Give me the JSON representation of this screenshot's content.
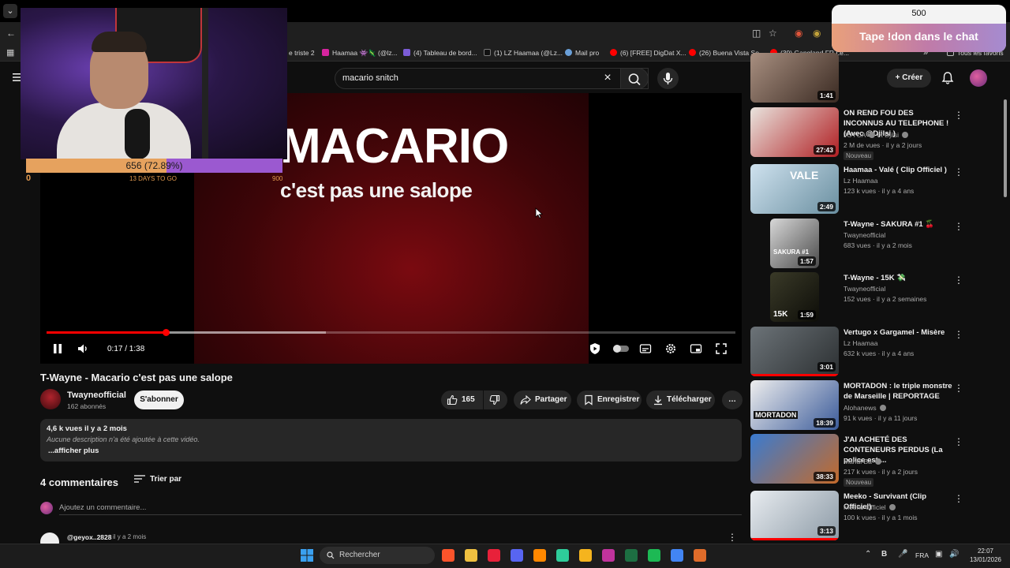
{
  "browser": {
    "bookmarks": [
      {
        "label": "e triste 2",
        "color": "#666666"
      },
      {
        "label": "Haamaa 👾🦎 (@lz...",
        "color": "#d6249f"
      },
      {
        "label": "(4) Tableau de bord...",
        "color": "#7b5cd6"
      },
      {
        "label": "(1) LZ Haamaa (@Lz...",
        "color": "#111111"
      },
      {
        "label": "Mail pro",
        "color": "#6a9fd8"
      },
      {
        "label": "(6) [FREE] DigDat X...",
        "color": "#ff0000"
      },
      {
        "label": "(26) Buena Vista So...",
        "color": "#ff0000"
      },
      {
        "label": "(39) Gangland FR Le...",
        "color": "#ff0000"
      }
    ],
    "favorites_label": "Tous les favoris",
    "more_glyph": "»"
  },
  "stream_overlay": {
    "goal": {
      "label": "656 (72.89%)",
      "min": "0",
      "max": "900",
      "days_left": "13 DAYS TO GO",
      "fraction": 0.7289
    },
    "donation": {
      "amount": "500",
      "cta": "Tape !don dans le chat"
    }
  },
  "masthead": {
    "search_query": "macario snitch",
    "create_label": "Créer"
  },
  "player": {
    "frame_line1": "MACARIO",
    "frame_line2": "c'est pas une salope",
    "time_display": "0:17 / 1:38",
    "played_fraction": 0.1735,
    "buffered_fraction": 0.405
  },
  "video": {
    "title": "T-Wayne - Macario c'est pas une salope",
    "channel": "Twayneofficial",
    "subscribers": "162 abonnés",
    "subscribe_label": "S'abonner",
    "likes": "165",
    "share_label": "Partager",
    "save_label": "Enregistrer",
    "download_label": "Télécharger",
    "description": {
      "meta": "4,6 k vues  il y a 2 mois",
      "text": "Aucune description n'a été ajoutée à cette vidéo.",
      "more": "...afficher plus"
    }
  },
  "comments": {
    "count_label": "4 commentaires",
    "sort_label": "Trier par",
    "add_placeholder": "Ajoutez un commentaire...",
    "first": {
      "author": "@geyox..2828",
      "time": "il y a 2 mois"
    }
  },
  "recommendations": [
    {
      "title": "",
      "channel": "",
      "meta": "",
      "duration": "1:41",
      "thumb": [
        "#a88f80",
        "#3a2a22"
      ]
    },
    {
      "title": "ON REND FOU DES INCONNUS AU TELEPHONE ! (Avec @Djilsi )",
      "channel": "JOYCA",
      "channel2": "et Djilsi",
      "meta": "2 M de vues · il y a 2 jours",
      "badge": "Nouveau",
      "duration": "27:43",
      "thumb": [
        "#e9e4de",
        "#b01e22"
      ]
    },
    {
      "title": "Haamaa - Valé ( Clip Officiel )",
      "channel": "Lz Haamaa",
      "meta": "123 k vues · il y a 4 ans",
      "duration": "2:49",
      "thumb": [
        "#cfe2ef",
        "#6a8fa0"
      ],
      "label": "VALE"
    },
    {
      "title": "T-Wayne - SAKURA #1 🍒",
      "channel": "Twayneofficial",
      "meta": "683 vues · il y a 2 mois",
      "duration": "1:57",
      "thumb": [
        "#d8d8d8",
        "#4a4a4a"
      ],
      "label": "SAKURA #1"
    },
    {
      "title": "T-Wayne - 15K 💸",
      "channel": "Twayneofficial",
      "meta": "152 vues · il y a 2 semaines",
      "duration": "1:59",
      "thumb": [
        "#3a3a28",
        "#0d0d08"
      ],
      "label": "15K"
    },
    {
      "title": "Vertugo x Gargamel - Misère",
      "channel": "Lz Haamaa",
      "meta": "632 k vues · il y a 4 ans",
      "duration": "3:01",
      "thumb": [
        "#6c7378",
        "#2c3032"
      ],
      "watched": 1.0
    },
    {
      "title": "MORTADON : le triple monstre de Marseille | REPORTAGE",
      "channel": "Alohanews",
      "meta": "91 k vues · il y a 11 jours",
      "duration": "18:39",
      "thumb": [
        "#eeeeee",
        "#3b5b9a"
      ],
      "label": "MORTADON"
    },
    {
      "title": "J'AI ACHETÉ DES CONTENEURS PERDUS (La police est ...",
      "channel": "Mahdi Ba",
      "meta": "217 k vues · il y a 2 jours",
      "badge": "Nouveau",
      "duration": "38:33",
      "thumb": [
        "#3a7bd0",
        "#c46a2a"
      ]
    },
    {
      "title": "Meeko - Survivant (Clip Officiel)",
      "channel": "Meeko Officiel",
      "meta": "100 k vues · il y a 1 mois",
      "duration": "3:13",
      "thumb": [
        "#e8ecf0",
        "#8c9aa6"
      ],
      "watched": 1.0
    }
  ],
  "taskbar": {
    "search_label": "Rechercher",
    "apps": [
      {
        "name": "brave",
        "color": "#fb542b"
      },
      {
        "name": "files",
        "color": "#f0c040"
      },
      {
        "name": "red-app",
        "color": "#e8213a"
      },
      {
        "name": "discord",
        "color": "#5865f2"
      },
      {
        "name": "vlc",
        "color": "#ff8800"
      },
      {
        "name": "bot",
        "color": "#2ecc9a"
      },
      {
        "name": "chat",
        "color": "#f5b41e"
      },
      {
        "name": "next",
        "color": "#c0339c"
      },
      {
        "name": "excel",
        "color": "#1d6f42"
      },
      {
        "name": "spotify",
        "color": "#1db954"
      },
      {
        "name": "chrome",
        "color": "#4285f4"
      },
      {
        "name": "git",
        "color": "#e06c2a"
      }
    ],
    "lang": "FRA",
    "time": "22:07",
    "date": "13/01/2026"
  }
}
